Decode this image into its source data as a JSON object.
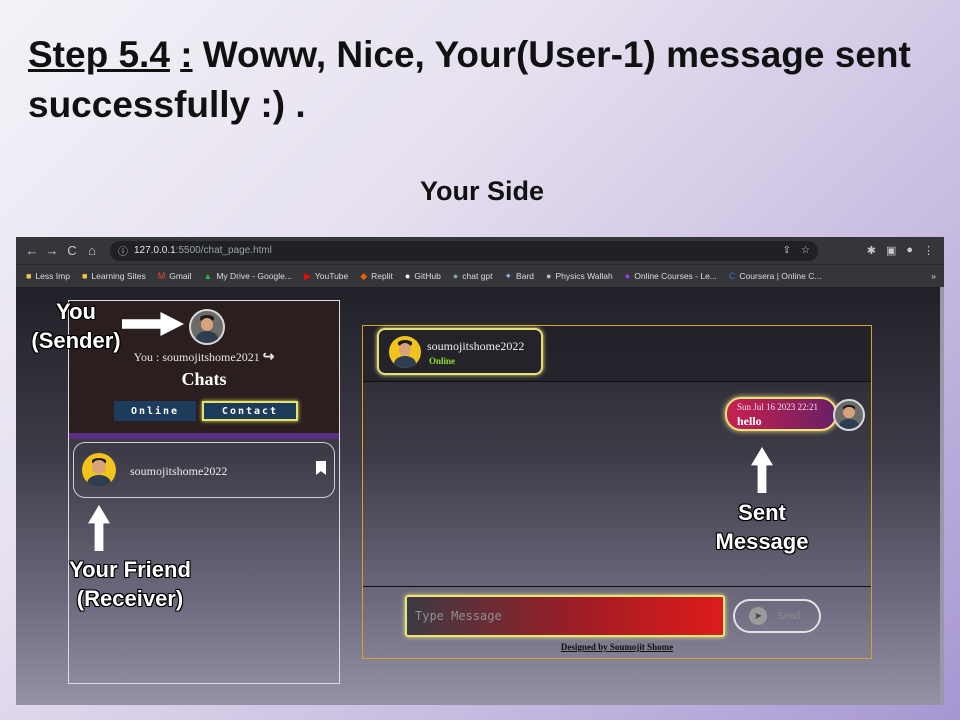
{
  "slide": {
    "step_label": "Step 5.4",
    "colon": ":",
    "heading_rest": " Woww, Nice, Your(User-1) message sent successfully :) .",
    "side_label": "Your Side"
  },
  "browser": {
    "url_host": "127.0.0.1",
    "url_path": ":5500/chat_page.html",
    "nav": {
      "back": "←",
      "forward": "→",
      "reload": "C",
      "home": "⌂",
      "info": "ⓘ"
    },
    "bookmarks": [
      {
        "label": "Less Imp",
        "icon": "folder-icon"
      },
      {
        "label": "Learning Sites",
        "icon": "folder-icon"
      },
      {
        "label": "Gmail",
        "icon": "gmail-icon"
      },
      {
        "label": "My Drive - Google...",
        "icon": "drive-icon"
      },
      {
        "label": "YouTube",
        "icon": "youtube-icon"
      },
      {
        "label": "Replit",
        "icon": "replit-icon"
      },
      {
        "label": "GitHub",
        "icon": "github-icon"
      },
      {
        "label": "chat gpt",
        "icon": "chatgpt-icon"
      },
      {
        "label": "Bard",
        "icon": "bard-icon"
      },
      {
        "label": "Physics Wallah",
        "icon": "pw-icon"
      },
      {
        "label": "Online Courses - Le...",
        "icon": "udemy-icon"
      },
      {
        "label": "Coursera | Online C...",
        "icon": "coursera-icon"
      }
    ],
    "bookmarks_more": "»"
  },
  "left_panel": {
    "you_label": "You : soumojitshome2021",
    "chats_title": "Chats",
    "tab_online": "Online",
    "tab_contact": "Contact",
    "friend_name": "soumojitshome2022"
  },
  "chat_panel": {
    "contact_name": "soumojitshome2022",
    "contact_status": "Online",
    "message": {
      "time": "Sun Jul 16 2023 22:21",
      "text": "hello"
    },
    "input_placeholder": "Type Message",
    "send_label": "Send",
    "credit": "Designed by Soumojit Shome"
  },
  "annotations": {
    "you": "You",
    "sender": "(Sender)",
    "friend": "Your Friend",
    "receiver": "(Receiver)",
    "sent": "Sent",
    "message": "Message"
  },
  "colors": {
    "accent_yellow": "#e6e26a",
    "online_green": "#8ae02b",
    "chat_border": "#d9a12a",
    "tab_blue": "#1d3b5a"
  }
}
